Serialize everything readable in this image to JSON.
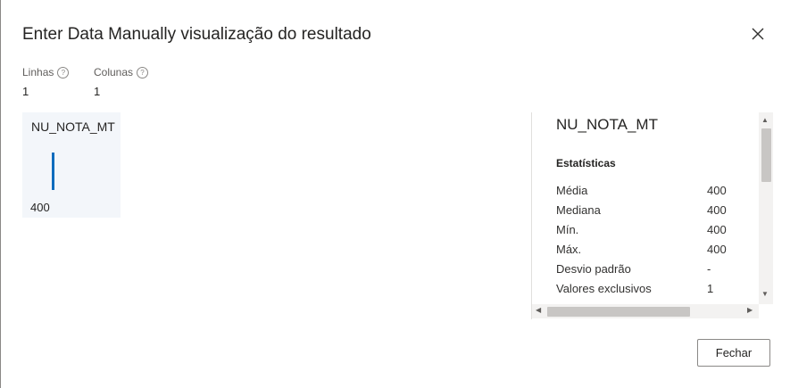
{
  "dialog": {
    "title": "Enter Data Manually visualização do resultado",
    "close_icon": "close-icon"
  },
  "meta": {
    "rows_label": "Linhas",
    "rows_value": "1",
    "cols_label": "Colunas",
    "cols_value": "1",
    "help_glyph": "?"
  },
  "column_card": {
    "name": "NU_NOTA_MT",
    "value": "400",
    "bar_color": "#0f6cbd"
  },
  "stats_panel": {
    "title": "NU_NOTA_MT",
    "subtitle": "Estatísticas",
    "rows": [
      {
        "key": "Média",
        "value": "400"
      },
      {
        "key": "Mediana",
        "value": "400"
      },
      {
        "key": "Mín.",
        "value": "400"
      },
      {
        "key": "Máx.",
        "value": "400"
      },
      {
        "key": "Desvio padrão",
        "value": "-"
      },
      {
        "key": "Valores exclusivos",
        "value": "1"
      }
    ]
  },
  "footer": {
    "close_button": "Fechar"
  }
}
